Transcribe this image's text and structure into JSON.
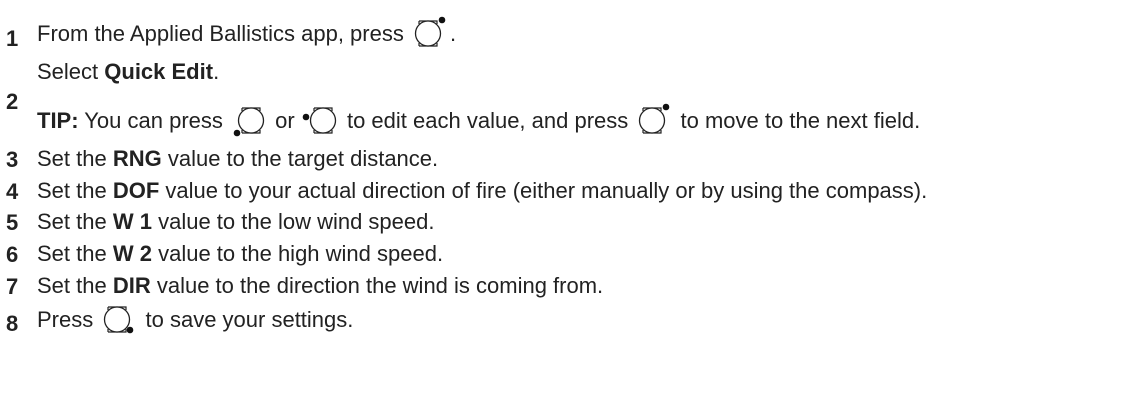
{
  "steps": [
    {
      "number": "1",
      "text_before": "From the Applied Ballistics app, press",
      "icon": "watch-button-upper-right-icon",
      "text_after": "."
    },
    {
      "number": "2",
      "text_before": "Select ",
      "bold": "Quick Edit",
      "text_after": ".",
      "tip": {
        "label": "TIP:",
        "part1": " You can press",
        "icon1": "watch-button-lower-left-icon",
        "part2": "or",
        "icon2": "watch-button-middle-left-icon",
        "part3": "to edit each value, and press",
        "icon3": "watch-button-upper-right-icon",
        "part4": "to move to the next field."
      }
    },
    {
      "number": "3",
      "text_before": "Set the ",
      "bold": "RNG",
      "text_after": " value to the target distance."
    },
    {
      "number": "4",
      "text_before": "Set the ",
      "bold": "DOF",
      "text_after": " value to your actual direction of fire (either manually or by using the compass)."
    },
    {
      "number": "5",
      "text_before": "Set the ",
      "bold": "W 1",
      "text_after": " value to the low wind speed."
    },
    {
      "number": "6",
      "text_before": "Set the ",
      "bold": "W 2",
      "text_after": " value to the high wind speed."
    },
    {
      "number": "7",
      "text_before": "Set the ",
      "bold": "DIR",
      "text_after": " value to the direction the wind is coming from."
    },
    {
      "number": "8",
      "text_before": "Press",
      "icon": "watch-button-lower-right-icon",
      "text_after": "to save your settings."
    }
  ]
}
